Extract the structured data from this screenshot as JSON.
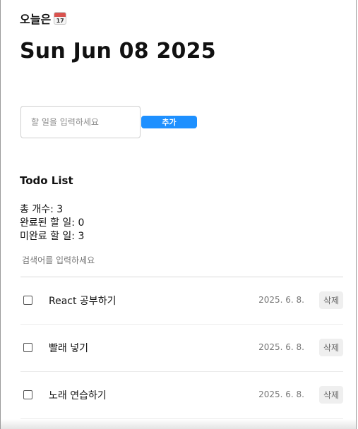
{
  "header": {
    "today_label": "오늘은",
    "calendar_icon": "calendar-icon",
    "calendar_number": "17",
    "date": "Sun Jun 08 2025"
  },
  "editor": {
    "input_placeholder": "할 일을 입력하세요",
    "input_value": "",
    "add_label": "추가",
    "accent_color": "#1e90ff"
  },
  "list": {
    "heading": "Todo List",
    "stats": {
      "total": "총 개수: 3",
      "done": "완료된 할 일: 0",
      "not_done": "미완료 할 일: 3"
    },
    "search_placeholder": "검색어를 입력하세요",
    "items": [
      {
        "checked": false,
        "text": "React 공부하기",
        "date": "2025. 6. 8.",
        "delete_label": "삭제"
      },
      {
        "checked": false,
        "text": "빨래 넣기",
        "date": "2025. 6. 8.",
        "delete_label": "삭제"
      },
      {
        "checked": false,
        "text": "노래 연습하기",
        "date": "2025. 6. 8.",
        "delete_label": "삭제"
      }
    ]
  }
}
